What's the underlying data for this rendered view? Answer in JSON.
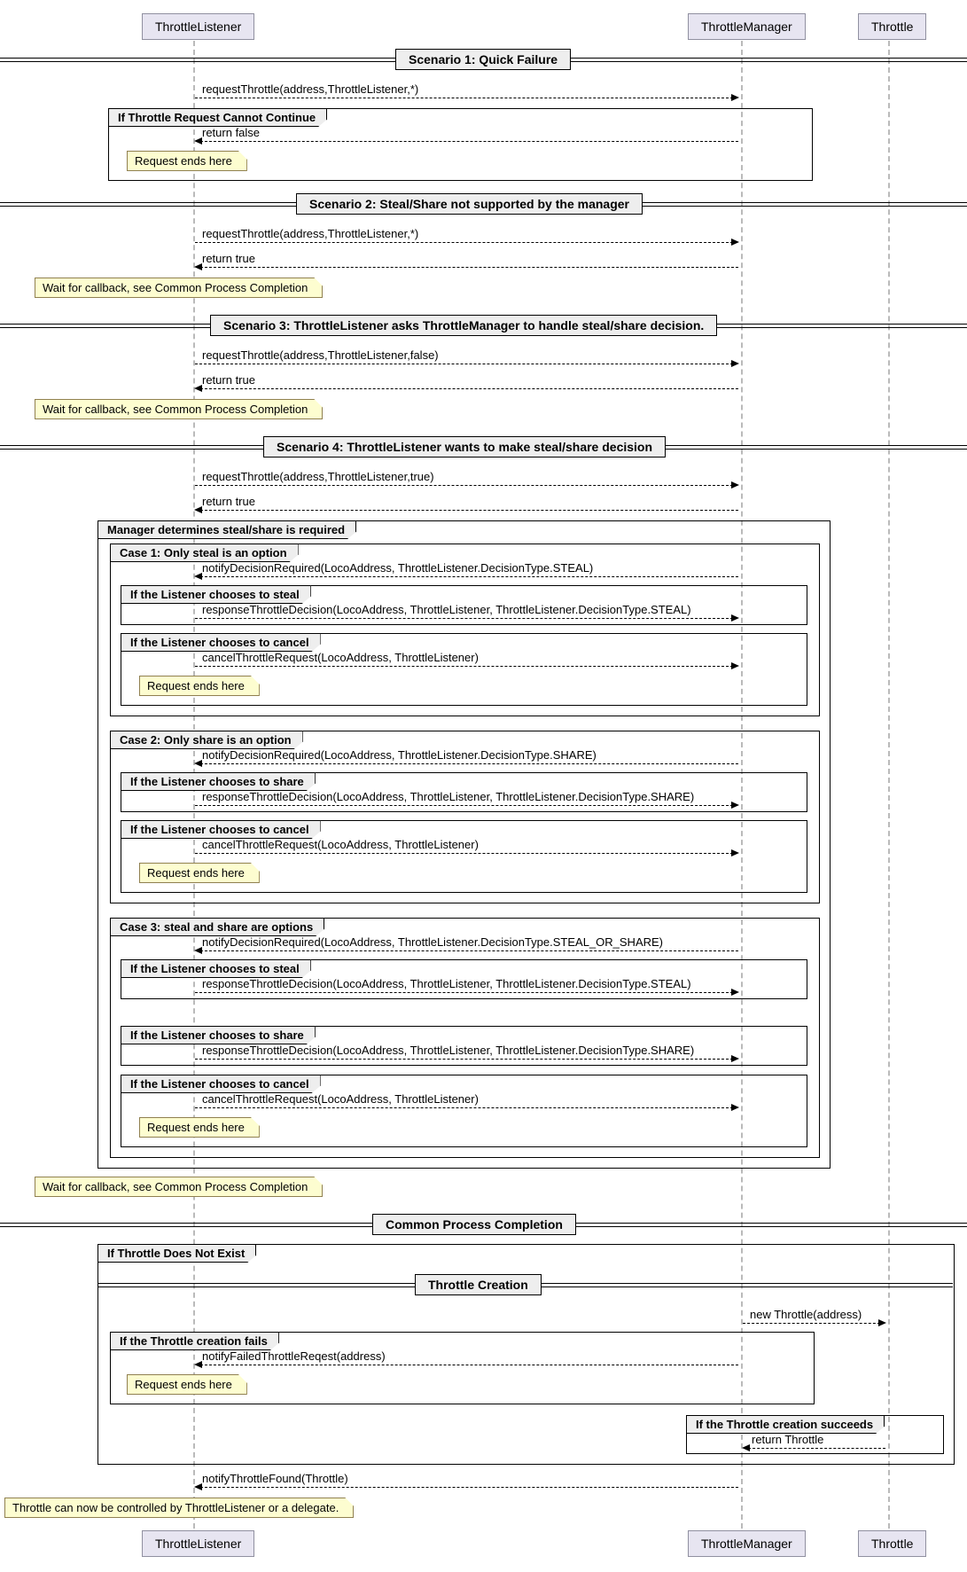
{
  "participants": {
    "throttleListener": "ThrottleListener",
    "throttleManager": "ThrottleManager",
    "throttle": "Throttle"
  },
  "dividers": {
    "scenario1": "Scenario 1: Quick Failure",
    "scenario2": "Scenario 2: Steal/Share not supported by the manager",
    "scenario3": "Scenario 3: ThrottleListener asks ThrottleManager to handle steal/share decision.",
    "scenario4": "Scenario 4: ThrottleListener wants to make steal/share decision",
    "commonCompletion": "Common Process Completion",
    "throttleCreation": "Throttle Creation"
  },
  "messages": {
    "requestThrottleStar": "requestThrottle(address,ThrottleListener,*)",
    "returnFalse": "return false",
    "returnTrue": "return true",
    "requestThrottleFalse": "requestThrottle(address,ThrottleListener,false)",
    "requestThrottleTrue": "requestThrottle(address,ThrottleListener,true)",
    "notifyDecisionSteal": "notifyDecisionRequired(LocoAddress, ThrottleListener.DecisionType.STEAL)",
    "notifyDecisionShare": "notifyDecisionRequired(LocoAddress, ThrottleListener.DecisionType.SHARE)",
    "notifyDecisionStealOrShare": "notifyDecisionRequired(LocoAddress, ThrottleListener.DecisionType.STEAL_OR_SHARE)",
    "responseDecisionSteal": "responseThrottleDecision(LocoAddress, ThrottleListener, ThrottleListener.DecisionType.STEAL)",
    "responseDecisionShare": "responseThrottleDecision(LocoAddress, ThrottleListener, ThrottleListener.DecisionType.SHARE)",
    "cancelThrottleRequest": "cancelThrottleRequest(LocoAddress, ThrottleListener)",
    "newThrottle": "new Throttle(address)",
    "notifyFailedReq": "notifyFailedThrottleReqest(address)",
    "returnThrottle": "return Throttle",
    "notifyThrottleFound": "notifyThrottleFound(Throttle)"
  },
  "groups": {
    "s1g1": "If Throttle Request Cannot Continue",
    "s4g0": "Manager determines steal/share is required",
    "s4c1": "Case 1: Only steal is an option",
    "s4c1a": "If the Listener chooses to steal",
    "s4c1b": "If the Listener chooses to cancel",
    "s4c2": "Case 2: Only share is an option",
    "s4c2a": "If the Listener chooses to share",
    "s4c2b": "If the Listener chooses to cancel",
    "s4c3": "Case 3: steal and share are options",
    "s4c3a": "If the Listener chooses to steal",
    "s4c3b": "If the Listener chooses to share",
    "s4c3c": "If the Listener chooses to cancel",
    "cpc1": "If Throttle Does Not Exist",
    "cpc2": "If the Throttle creation fails",
    "cpc3": "If the Throttle creation succeeds"
  },
  "notes": {
    "requestEnds": "Request ends here",
    "waitCallback": "Wait for callback, see Common Process Completion",
    "canControl": "Throttle can now be controlled by ThrottleListener or a delegate."
  }
}
